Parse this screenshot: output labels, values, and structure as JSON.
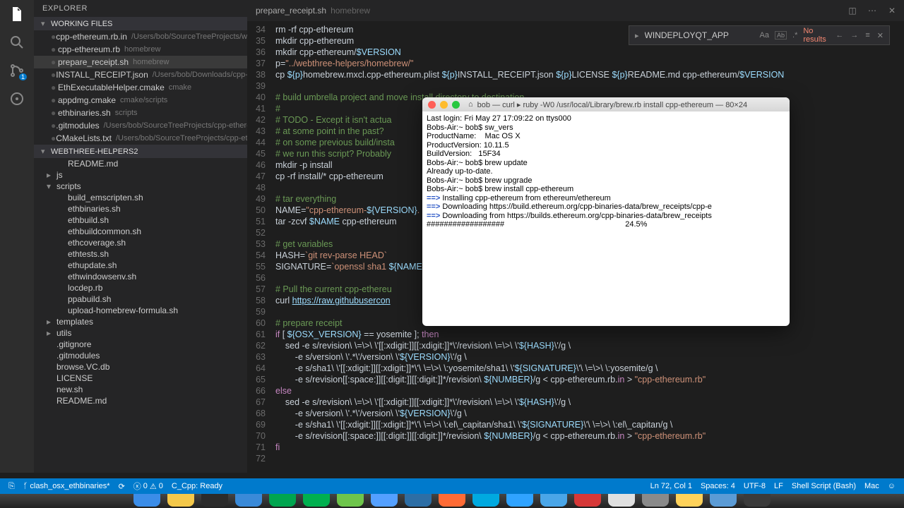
{
  "sidebar": {
    "title": "EXPLORER",
    "working_header": "WORKING FILES",
    "working_files": [
      {
        "name": "cpp-ethereum.rb.in",
        "path": "/Users/bob/SourceTreeProjects/web..."
      },
      {
        "name": "cpp-ethereum.rb",
        "path": "homebrew"
      },
      {
        "name": "prepare_receipt.sh",
        "path": "homebrew",
        "selected": true
      },
      {
        "name": "INSTALL_RECEIPT.json",
        "path": "/Users/bob/Downloads/cpp-eth..."
      },
      {
        "name": "EthExecutableHelper.cmake",
        "path": "cmake"
      },
      {
        "name": "appdmg.cmake",
        "path": "cmake/scripts"
      },
      {
        "name": "ethbinaries.sh",
        "path": "scripts"
      },
      {
        "name": ".gitmodules",
        "path": "/Users/bob/SourceTreeProjects/cpp-ethereum"
      },
      {
        "name": "CMakeLists.txt",
        "path": "/Users/bob/SourceTreeProjects/cpp-ethe..."
      }
    ],
    "folder_header": "WEBTHREE-HELPERS2",
    "tree": [
      {
        "label": "README.md",
        "indent": 1
      },
      {
        "label": "js",
        "indent": 0,
        "chev": "▸"
      },
      {
        "label": "scripts",
        "indent": 0,
        "chev": "▾"
      },
      {
        "label": "build_emscripten.sh",
        "indent": 1
      },
      {
        "label": "ethbinaries.sh",
        "indent": 1
      },
      {
        "label": "ethbuild.sh",
        "indent": 1
      },
      {
        "label": "ethbuildcommon.sh",
        "indent": 1
      },
      {
        "label": "ethcoverage.sh",
        "indent": 1
      },
      {
        "label": "ethtests.sh",
        "indent": 1
      },
      {
        "label": "ethupdate.sh",
        "indent": 1
      },
      {
        "label": "ethwindowsenv.sh",
        "indent": 1
      },
      {
        "label": "locdep.rb",
        "indent": 1
      },
      {
        "label": "ppabuild.sh",
        "indent": 1
      },
      {
        "label": "upload-homebrew-formula.sh",
        "indent": 1
      },
      {
        "label": "templates",
        "indent": 0,
        "chev": "▸"
      },
      {
        "label": "utils",
        "indent": 0,
        "chev": "▸"
      },
      {
        "label": ".gitignore",
        "indent": 0
      },
      {
        "label": ".gitmodules",
        "indent": 0
      },
      {
        "label": "browse.VC.db",
        "indent": 0
      },
      {
        "label": "LICENSE",
        "indent": 0
      },
      {
        "label": "new.sh",
        "indent": 0
      },
      {
        "label": "README.md",
        "indent": 0
      }
    ]
  },
  "tab": {
    "name": "prepare_receipt.sh",
    "folder": "homebrew"
  },
  "find": {
    "value": "WINDEPLOYQT_APP",
    "no_results": "No results"
  },
  "code_lines": [
    {
      "n": 34,
      "raw": "rm -rf cpp-ethereum"
    },
    {
      "n": 35,
      "raw": "mkdir cpp-ethereum"
    },
    {
      "n": 36,
      "html": "mkdir cpp-ethereum/<span class='c-var'>$VERSION</span>"
    },
    {
      "n": 37,
      "html": "p=<span class='c-str'>\"../webthree-helpers/homebrew/\"</span>"
    },
    {
      "n": 38,
      "html": "cp <span class='c-var'>${p}</span>homebrew.mxcl.cpp-ethereum.plist <span class='c-var'>${p}</span>INSTALL_RECEIPT.json <span class='c-var'>${p}</span>LICENSE <span class='c-var'>${p}</span>README.md cpp-ethereum/<span class='c-var'>$VERSION</span>"
    },
    {
      "n": 39,
      "raw": ""
    },
    {
      "n": 40,
      "html": "<span class='c-comment'># build umbrella project and move install directory to destination</span>"
    },
    {
      "n": 41,
      "html": "<span class='c-comment'>#</span>"
    },
    {
      "n": 42,
      "html": "<span class='c-comment'># TODO - Except it isn't actua</span>"
    },
    {
      "n": 43,
      "html": "<span class='c-comment'># at some point in the past?  </span>"
    },
    {
      "n": 44,
      "html": "<span class='c-comment'># on some previous build/insta</span>"
    },
    {
      "n": 45,
      "html": "<span class='c-comment'># we run this script? Probably</span>"
    },
    {
      "n": 46,
      "raw": "mkdir -p install"
    },
    {
      "n": 47,
      "html": "cp -rf install/* cpp-ethereum"
    },
    {
      "n": 48,
      "raw": ""
    },
    {
      "n": 49,
      "html": "<span class='c-comment'># tar everything</span>"
    },
    {
      "n": 50,
      "html": "NAME=<span class='c-str'>\"cpp-ethereum-</span><span class='c-var'>${VERSION}</span><span class='c-str'>.</span>"
    },
    {
      "n": 51,
      "html": "tar -zcvf <span class='c-var'>$NAME</span> cpp-ethereum"
    },
    {
      "n": 52,
      "raw": ""
    },
    {
      "n": 53,
      "html": "<span class='c-comment'># get variables</span>"
    },
    {
      "n": 54,
      "html": "HASH=<span class='c-str'>`git rev-parse HEAD`</span>"
    },
    {
      "n": 55,
      "html": "SIGNATURE=<span class='c-str'>`openssl sha1 </span><span class='c-var'>${NAME</span>"
    },
    {
      "n": 56,
      "raw": ""
    },
    {
      "n": 57,
      "html": "<span class='c-comment'># Pull the current cpp-ethereu</span>"
    },
    {
      "n": 58,
      "html": "curl <span style='text-decoration:underline;color:#9cdcfe'>https://raw.githubusercon</span>"
    },
    {
      "n": 59,
      "raw": ""
    },
    {
      "n": 60,
      "html": "<span class='c-comment'># prepare receipt</span>"
    },
    {
      "n": 61,
      "html": "<span class='c-key'>if</span> [ <span class='c-var'>${OSX_VERSION}</span> == yosemite ]; <span class='c-key'>then</span>"
    },
    {
      "n": 62,
      "html": "    sed -e s/revision\\ \\=\\&gt;\\ \\'[[:xdigit:]][[:xdigit:]]*\\'/revision\\ \\=\\&gt;\\ \\'<span class='c-var'>${HASH}</span>\\'/g \\"
    },
    {
      "n": 63,
      "html": "        -e s/version\\ \\'.*\\'/version\\ \\'<span class='c-var'>${VERSION}</span>\\'/g \\"
    },
    {
      "n": 64,
      "html": "        -e s/sha1\\ \\'[[:xdigit:]][[:xdigit:]]*\\'\\ \\=\\&gt;\\ \\:yosemite/sha1\\ \\'<span class='c-var'>${SIGNATURE}</span>\\'\\ \\=\\&gt;\\ \\:yosemite/g \\"
    },
    {
      "n": 65,
      "html": "        -e s/revision[[:space:]][[:digit:]][[:digit:]]*/revision\\ <span class='c-var'>${NUMBER}</span>/g &lt; cpp-ethereum.rb.<span class='c-key'>in</span> &gt; <span class='c-str'>\"cpp-ethereum.rb\"</span>"
    },
    {
      "n": 66,
      "html": "<span class='c-key'>else</span>"
    },
    {
      "n": 67,
      "html": "    sed -e s/revision\\ \\=\\&gt;\\ \\'[[:xdigit:]][[:xdigit:]]*\\'/revision\\ \\=\\&gt;\\ \\'<span class='c-var'>${HASH}</span>\\'/g \\"
    },
    {
      "n": 68,
      "html": "        -e s/version\\ \\'.*\\'/version\\ \\'<span class='c-var'>${VERSION}</span>\\'/g \\"
    },
    {
      "n": 69,
      "html": "        -e s/sha1\\ \\'[[:xdigit:]][[:xdigit:]]*\\'\\ \\=\\&gt;\\ \\:el\\_capitan/sha1\\ \\'<span class='c-var'>${SIGNATURE}</span>\\'\\ \\=\\&gt;\\ \\:el\\_capitan/g \\"
    },
    {
      "n": 70,
      "html": "        -e s/revision[[:space:]][[:digit:]][[:digit:]]*/revision\\ <span class='c-var'>${NUMBER}</span>/g &lt; cpp-ethereum.rb.<span class='c-key'>in</span> &gt; <span class='c-str'>\"cpp-ethereum.rb\"</span>"
    },
    {
      "n": 71,
      "html": "<span class='c-key'>fi</span>"
    },
    {
      "n": 72,
      "raw": ""
    }
  ],
  "terminal": {
    "title": "bob — curl ▸ ruby -W0 /usr/local/Library/brew.rb install cpp-ethereum — 80×24",
    "lines": [
      {
        "t": "Last login: Fri May 27 17:09:22 on ttys000"
      },
      {
        "t": "Bobs-Air:~ bob$ sw_vers"
      },
      {
        "t": "ProductName:    Mac OS X"
      },
      {
        "t": "ProductVersion: 10.11.5"
      },
      {
        "t": "BuildVersion:   15F34"
      },
      {
        "t": "Bobs-Air:~ bob$ brew update"
      },
      {
        "t": "Already up-to-date."
      },
      {
        "t": "Bobs-Air:~ bob$ brew upgrade"
      },
      {
        "t": "Bobs-Air:~ bob$ brew install cpp-ethereum"
      },
      {
        "b": "==> ",
        "t": "Installing cpp-ethereum from ethereum/ethereum"
      },
      {
        "b": "==> ",
        "t": "Downloading https://build.ethereum.org/cpp-binaries-data/brew_receipts/cpp-e"
      },
      {
        "b": "==> ",
        "t": "Downloading from https://builds.ethereum.org/cpp-binaries-data/brew_receipts"
      },
      {
        "p": "##################                                                        24.5%"
      }
    ]
  },
  "status": {
    "branch": "clash_osx_ethbinaries*",
    "errors": "0",
    "warnings": "0",
    "cpp": "C_Cpp: Ready",
    "pos": "Ln 72, Col 1",
    "spaces": "Spaces: 4",
    "enc": "UTF-8",
    "eol": "LF",
    "lang": "Shell Script (Bash)",
    "os": "Mac"
  },
  "dock_colors": [
    "#3b8de8",
    "#f4c84a",
    "#2b2b2b",
    "#3a8ad8",
    "#00a54f",
    "#00b04f",
    "#6ec54b",
    "#54a0ff",
    "#2d6ea5",
    "#ff6b35",
    "#00a9e0",
    "#2fa3ff",
    "#4aa6e8",
    "#d63838",
    "#e0e0e0",
    "#8a8a8a",
    "#ffd25a",
    "#5b9bd5",
    "#3b3b3b"
  ]
}
